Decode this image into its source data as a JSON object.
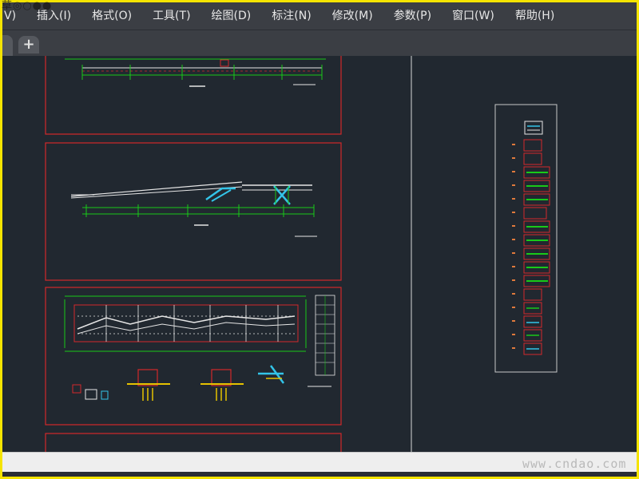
{
  "menu": {
    "items": [
      {
        "id": "view",
        "label": "V)"
      },
      {
        "id": "insert",
        "label": "插入(I)"
      },
      {
        "id": "format",
        "label": "格式(O)"
      },
      {
        "id": "tools",
        "label": "工具(T)"
      },
      {
        "id": "draw",
        "label": "绘图(D)"
      },
      {
        "id": "dimension",
        "label": "标注(N)"
      },
      {
        "id": "modify",
        "label": "修改(M)"
      },
      {
        "id": "parameter",
        "label": "参数(P)"
      },
      {
        "id": "window",
        "label": "窗口(W)"
      },
      {
        "id": "help",
        "label": "帮助(H)"
      }
    ]
  },
  "tabs": {
    "new_tab_symbol": "+"
  },
  "watermark": {
    "text": "www.cndao.com"
  },
  "colors": {
    "canvas": "#212830",
    "sheet_border": "#d2292b",
    "dimension": "#19c919",
    "structure": "#e6e6e6",
    "brace": "#33c4e8",
    "accent": "#e6c200",
    "sheet_set_border": "#c8c8c8"
  }
}
